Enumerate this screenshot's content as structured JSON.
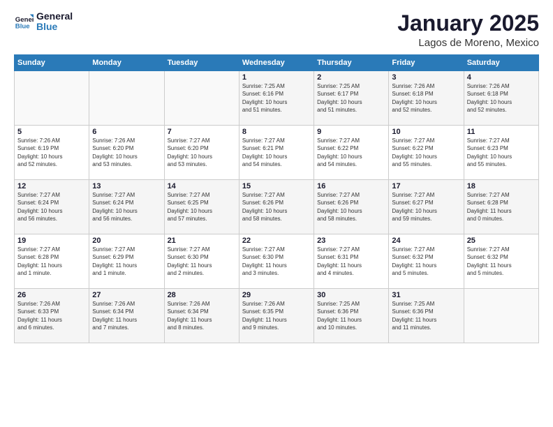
{
  "logo": {
    "line1": "General",
    "line2": "Blue"
  },
  "title": "January 2025",
  "subtitle": "Lagos de Moreno, Mexico",
  "weekdays": [
    "Sunday",
    "Monday",
    "Tuesday",
    "Wednesday",
    "Thursday",
    "Friday",
    "Saturday"
  ],
  "weeks": [
    [
      {
        "day": "",
        "info": ""
      },
      {
        "day": "",
        "info": ""
      },
      {
        "day": "",
        "info": ""
      },
      {
        "day": "1",
        "info": "Sunrise: 7:25 AM\nSunset: 6:16 PM\nDaylight: 10 hours\nand 51 minutes."
      },
      {
        "day": "2",
        "info": "Sunrise: 7:25 AM\nSunset: 6:17 PM\nDaylight: 10 hours\nand 51 minutes."
      },
      {
        "day": "3",
        "info": "Sunrise: 7:26 AM\nSunset: 6:18 PM\nDaylight: 10 hours\nand 52 minutes."
      },
      {
        "day": "4",
        "info": "Sunrise: 7:26 AM\nSunset: 6:18 PM\nDaylight: 10 hours\nand 52 minutes."
      }
    ],
    [
      {
        "day": "5",
        "info": "Sunrise: 7:26 AM\nSunset: 6:19 PM\nDaylight: 10 hours\nand 52 minutes."
      },
      {
        "day": "6",
        "info": "Sunrise: 7:26 AM\nSunset: 6:20 PM\nDaylight: 10 hours\nand 53 minutes."
      },
      {
        "day": "7",
        "info": "Sunrise: 7:27 AM\nSunset: 6:20 PM\nDaylight: 10 hours\nand 53 minutes."
      },
      {
        "day": "8",
        "info": "Sunrise: 7:27 AM\nSunset: 6:21 PM\nDaylight: 10 hours\nand 54 minutes."
      },
      {
        "day": "9",
        "info": "Sunrise: 7:27 AM\nSunset: 6:22 PM\nDaylight: 10 hours\nand 54 minutes."
      },
      {
        "day": "10",
        "info": "Sunrise: 7:27 AM\nSunset: 6:22 PM\nDaylight: 10 hours\nand 55 minutes."
      },
      {
        "day": "11",
        "info": "Sunrise: 7:27 AM\nSunset: 6:23 PM\nDaylight: 10 hours\nand 55 minutes."
      }
    ],
    [
      {
        "day": "12",
        "info": "Sunrise: 7:27 AM\nSunset: 6:24 PM\nDaylight: 10 hours\nand 56 minutes."
      },
      {
        "day": "13",
        "info": "Sunrise: 7:27 AM\nSunset: 6:24 PM\nDaylight: 10 hours\nand 56 minutes."
      },
      {
        "day": "14",
        "info": "Sunrise: 7:27 AM\nSunset: 6:25 PM\nDaylight: 10 hours\nand 57 minutes."
      },
      {
        "day": "15",
        "info": "Sunrise: 7:27 AM\nSunset: 6:26 PM\nDaylight: 10 hours\nand 58 minutes."
      },
      {
        "day": "16",
        "info": "Sunrise: 7:27 AM\nSunset: 6:26 PM\nDaylight: 10 hours\nand 58 minutes."
      },
      {
        "day": "17",
        "info": "Sunrise: 7:27 AM\nSunset: 6:27 PM\nDaylight: 10 hours\nand 59 minutes."
      },
      {
        "day": "18",
        "info": "Sunrise: 7:27 AM\nSunset: 6:28 PM\nDaylight: 11 hours\nand 0 minutes."
      }
    ],
    [
      {
        "day": "19",
        "info": "Sunrise: 7:27 AM\nSunset: 6:28 PM\nDaylight: 11 hours\nand 1 minute."
      },
      {
        "day": "20",
        "info": "Sunrise: 7:27 AM\nSunset: 6:29 PM\nDaylight: 11 hours\nand 1 minute."
      },
      {
        "day": "21",
        "info": "Sunrise: 7:27 AM\nSunset: 6:30 PM\nDaylight: 11 hours\nand 2 minutes."
      },
      {
        "day": "22",
        "info": "Sunrise: 7:27 AM\nSunset: 6:30 PM\nDaylight: 11 hours\nand 3 minutes."
      },
      {
        "day": "23",
        "info": "Sunrise: 7:27 AM\nSunset: 6:31 PM\nDaylight: 11 hours\nand 4 minutes."
      },
      {
        "day": "24",
        "info": "Sunrise: 7:27 AM\nSunset: 6:32 PM\nDaylight: 11 hours\nand 5 minutes."
      },
      {
        "day": "25",
        "info": "Sunrise: 7:27 AM\nSunset: 6:32 PM\nDaylight: 11 hours\nand 5 minutes."
      }
    ],
    [
      {
        "day": "26",
        "info": "Sunrise: 7:26 AM\nSunset: 6:33 PM\nDaylight: 11 hours\nand 6 minutes."
      },
      {
        "day": "27",
        "info": "Sunrise: 7:26 AM\nSunset: 6:34 PM\nDaylight: 11 hours\nand 7 minutes."
      },
      {
        "day": "28",
        "info": "Sunrise: 7:26 AM\nSunset: 6:34 PM\nDaylight: 11 hours\nand 8 minutes."
      },
      {
        "day": "29",
        "info": "Sunrise: 7:26 AM\nSunset: 6:35 PM\nDaylight: 11 hours\nand 9 minutes."
      },
      {
        "day": "30",
        "info": "Sunrise: 7:25 AM\nSunset: 6:36 PM\nDaylight: 11 hours\nand 10 minutes."
      },
      {
        "day": "31",
        "info": "Sunrise: 7:25 AM\nSunset: 6:36 PM\nDaylight: 11 hours\nand 11 minutes."
      },
      {
        "day": "",
        "info": ""
      }
    ]
  ]
}
